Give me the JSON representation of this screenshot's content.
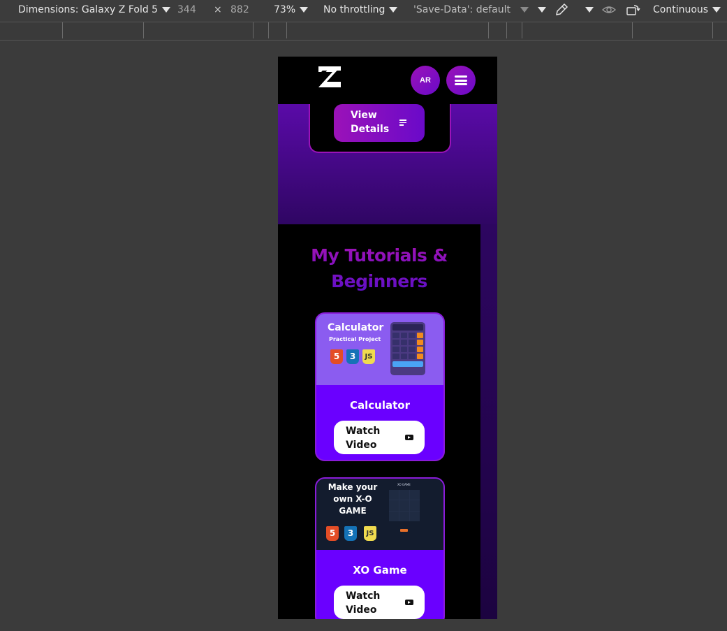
{
  "devtools": {
    "dimensions_label": "Dimensions: Galaxy Z Fold 5",
    "width": "344",
    "times": "×",
    "height": "882",
    "zoom": "73%",
    "throttling": "No throttling",
    "save_data": "'Save-Data': default",
    "mode": "Continuous"
  },
  "header": {
    "avatar_initials": "AR"
  },
  "project": {
    "view_label": "View Details"
  },
  "tutorials": {
    "section_title": "My Tutorials & Beginners",
    "cards": [
      {
        "thumb_heading": "Calculator",
        "thumb_subheading": "Practical Project",
        "title": "Calculator",
        "watch_label": "Watch Video"
      },
      {
        "thumb_heading": "Make your own X-O GAME",
        "thumb_game_title": "XO GAME",
        "title": "XO Game",
        "watch_label": "Watch Video"
      }
    ],
    "badges": [
      "5",
      "3",
      "JS"
    ]
  },
  "colors": {
    "accent_purple": "#6a00ff",
    "magenta": "#9b12b8",
    "calc_thumb": "#8b5cf0",
    "xo_thumb": "#131c2e"
  }
}
